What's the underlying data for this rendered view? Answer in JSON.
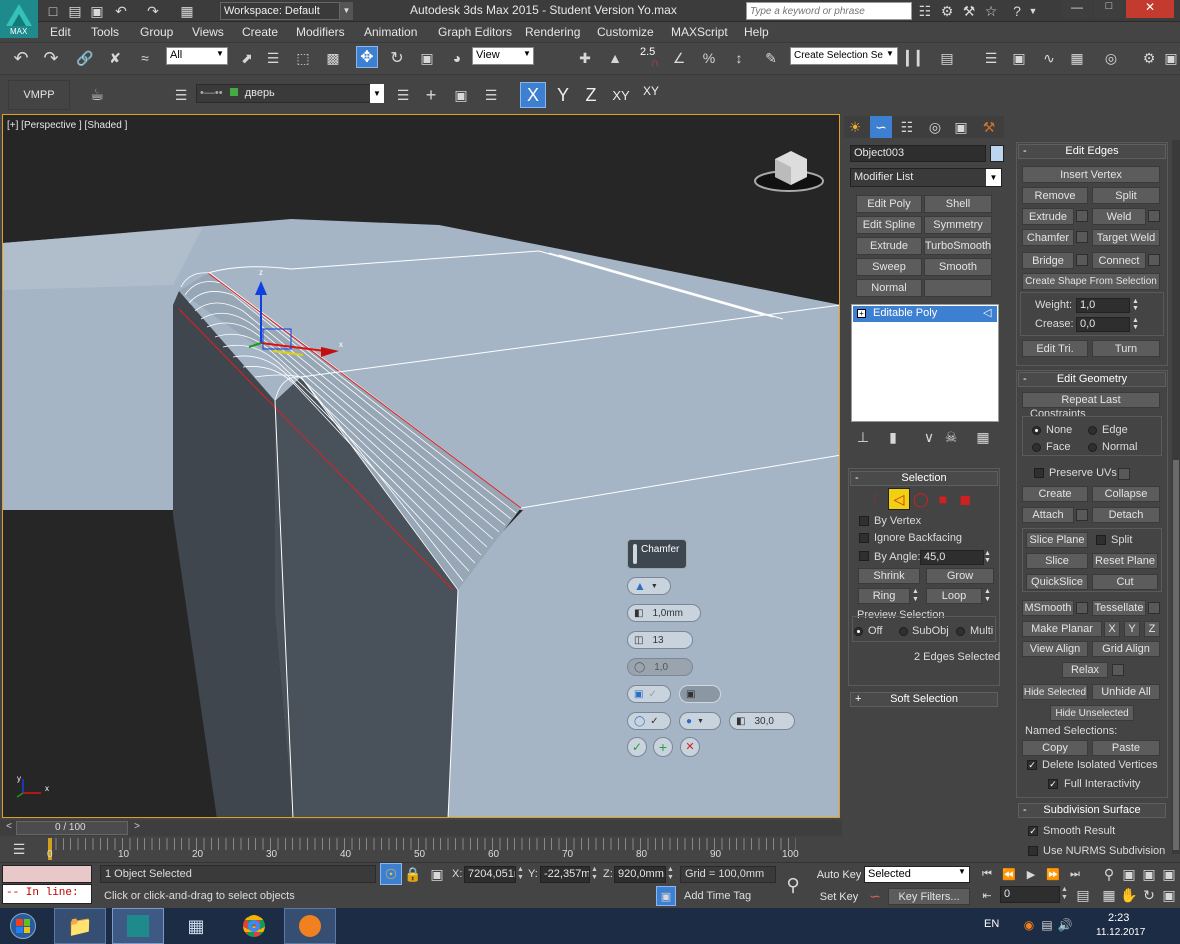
{
  "title_bar": {
    "workspace": "Workspace: Default",
    "title": "Autodesk 3ds Max  2015   - Student Version    Yo.max",
    "search_placeholder": "Type a keyword or phrase",
    "app_label": "MAX"
  },
  "menu": [
    "Edit",
    "Tools",
    "Group",
    "Views",
    "Create",
    "Modifiers",
    "Animation",
    "Graph Editors",
    "Rendering",
    "Customize",
    "MAXScript",
    "Help"
  ],
  "toolbar": {
    "filter": "All",
    "ref_coord": "View",
    "snap_angle": "2.5",
    "named_sel": "Create Selection Se",
    "vmpp": "VMPP",
    "layer": "дверь",
    "axes": [
      "X",
      "Y",
      "Z",
      "XY",
      "XY"
    ]
  },
  "viewport": {
    "label": "[+] [Perspective ] [Shaded ]",
    "gizmo_z": "z",
    "gizmo_x": "x",
    "axis_y": "y",
    "axis_x": "x",
    "caddy": {
      "title": "Chamfer",
      "amount": "1,0mm",
      "segments": "13",
      "tension": "1,0",
      "angle": "30,0"
    }
  },
  "command_panel": {
    "object_name": "Object003",
    "modifier_list": "Modifier List",
    "modifier_buttons": [
      "Edit Poly",
      "Shell",
      "Edit Spline",
      "Symmetry",
      "Extrude",
      "TurboSmooth",
      "Sweep",
      "Smooth",
      "Normal",
      ""
    ],
    "stack_item": "Editable Poly",
    "selection": {
      "header": "Selection",
      "by_vertex": "By Vertex",
      "ignore_backfacing": "Ignore Backfacing",
      "by_angle": "By Angle:",
      "angle_value": "45,0",
      "shrink": "Shrink",
      "grow": "Grow",
      "ring": "Ring",
      "loop": "Loop",
      "preview": "Preview Selection",
      "off": "Off",
      "subobj": "SubObj",
      "multi": "Multi",
      "status": "2 Edges Selected"
    },
    "soft_selection": "Soft Selection"
  },
  "edit_edges": {
    "header": "Edit Edges",
    "insert_vertex": "Insert Vertex",
    "remove": "Remove",
    "split": "Split",
    "extrude": "Extrude",
    "weld": "Weld",
    "chamfer": "Chamfer",
    "target_weld": "Target Weld",
    "bridge": "Bridge",
    "connect": "Connect",
    "create_shape": "Create Shape From Selection",
    "weight_label": "Weight:",
    "weight": "1,0",
    "crease_label": "Crease:",
    "crease": "0,0",
    "edit_tri": "Edit Tri.",
    "turn": "Turn"
  },
  "edit_geometry": {
    "header": "Edit Geometry",
    "repeat_last": "Repeat Last",
    "constraints": "Constraints",
    "none": "None",
    "edge": "Edge",
    "face": "Face",
    "normal": "Normal",
    "preserve_uvs": "Preserve UVs",
    "create": "Create",
    "collapse": "Collapse",
    "attach": "Attach",
    "detach": "Detach",
    "slice_plane": "Slice Plane",
    "split": "Split",
    "slice": "Slice",
    "reset_plane": "Reset Plane",
    "quickslice": "QuickSlice",
    "cut": "Cut",
    "msmooth": "MSmooth",
    "tessellate": "Tessellate",
    "make_planar": "Make Planar",
    "x": "X",
    "y": "Y",
    "z": "Z",
    "view_align": "View Align",
    "grid_align": "Grid Align",
    "relax": "Relax",
    "hide_selected": "Hide Selected",
    "unhide_all": "Unhide All",
    "hide_unselected": "Hide Unselected",
    "named_selections": "Named Selections:",
    "copy": "Copy",
    "paste": "Paste",
    "delete_isolated": "Delete Isolated Vertices",
    "full_interactivity": "Full Interactivity"
  },
  "subdivision": {
    "header": "Subdivision Surface",
    "smooth_result": "Smooth Result",
    "use_nurms": "Use NURMS Subdivision"
  },
  "timeline": {
    "frame": "0 / 100",
    "ticks": [
      "0",
      "10",
      "20",
      "30",
      "40",
      "50",
      "60",
      "70",
      "80",
      "90",
      "100"
    ]
  },
  "status": {
    "script": "-- In line:",
    "selected": "1 Object Selected",
    "prompt": "Click or click-and-drag to select objects",
    "x_label": "X:",
    "x": "7204,051m",
    "y_label": "Y:",
    "y": "-22,357mm",
    "z_label": "Z:",
    "z": "920,0mm",
    "grid": "Grid = 100,0mm",
    "add_time_tag": "Add Time Tag",
    "auto_key": "Auto Key",
    "set_key": "Set Key",
    "selected_dd": "Selected",
    "key_filters": "Key Filters...",
    "frame_field": "0"
  },
  "taskbar": {
    "lang": "EN",
    "time": "2:23",
    "date": "11.12.2017"
  },
  "colors": {
    "viewport_bg": "#262626",
    "model_top": "#a9b8c8",
    "model_side": "#4b5258",
    "accent_blue": "#3d7fd0",
    "selected_edge": "#e02020"
  }
}
